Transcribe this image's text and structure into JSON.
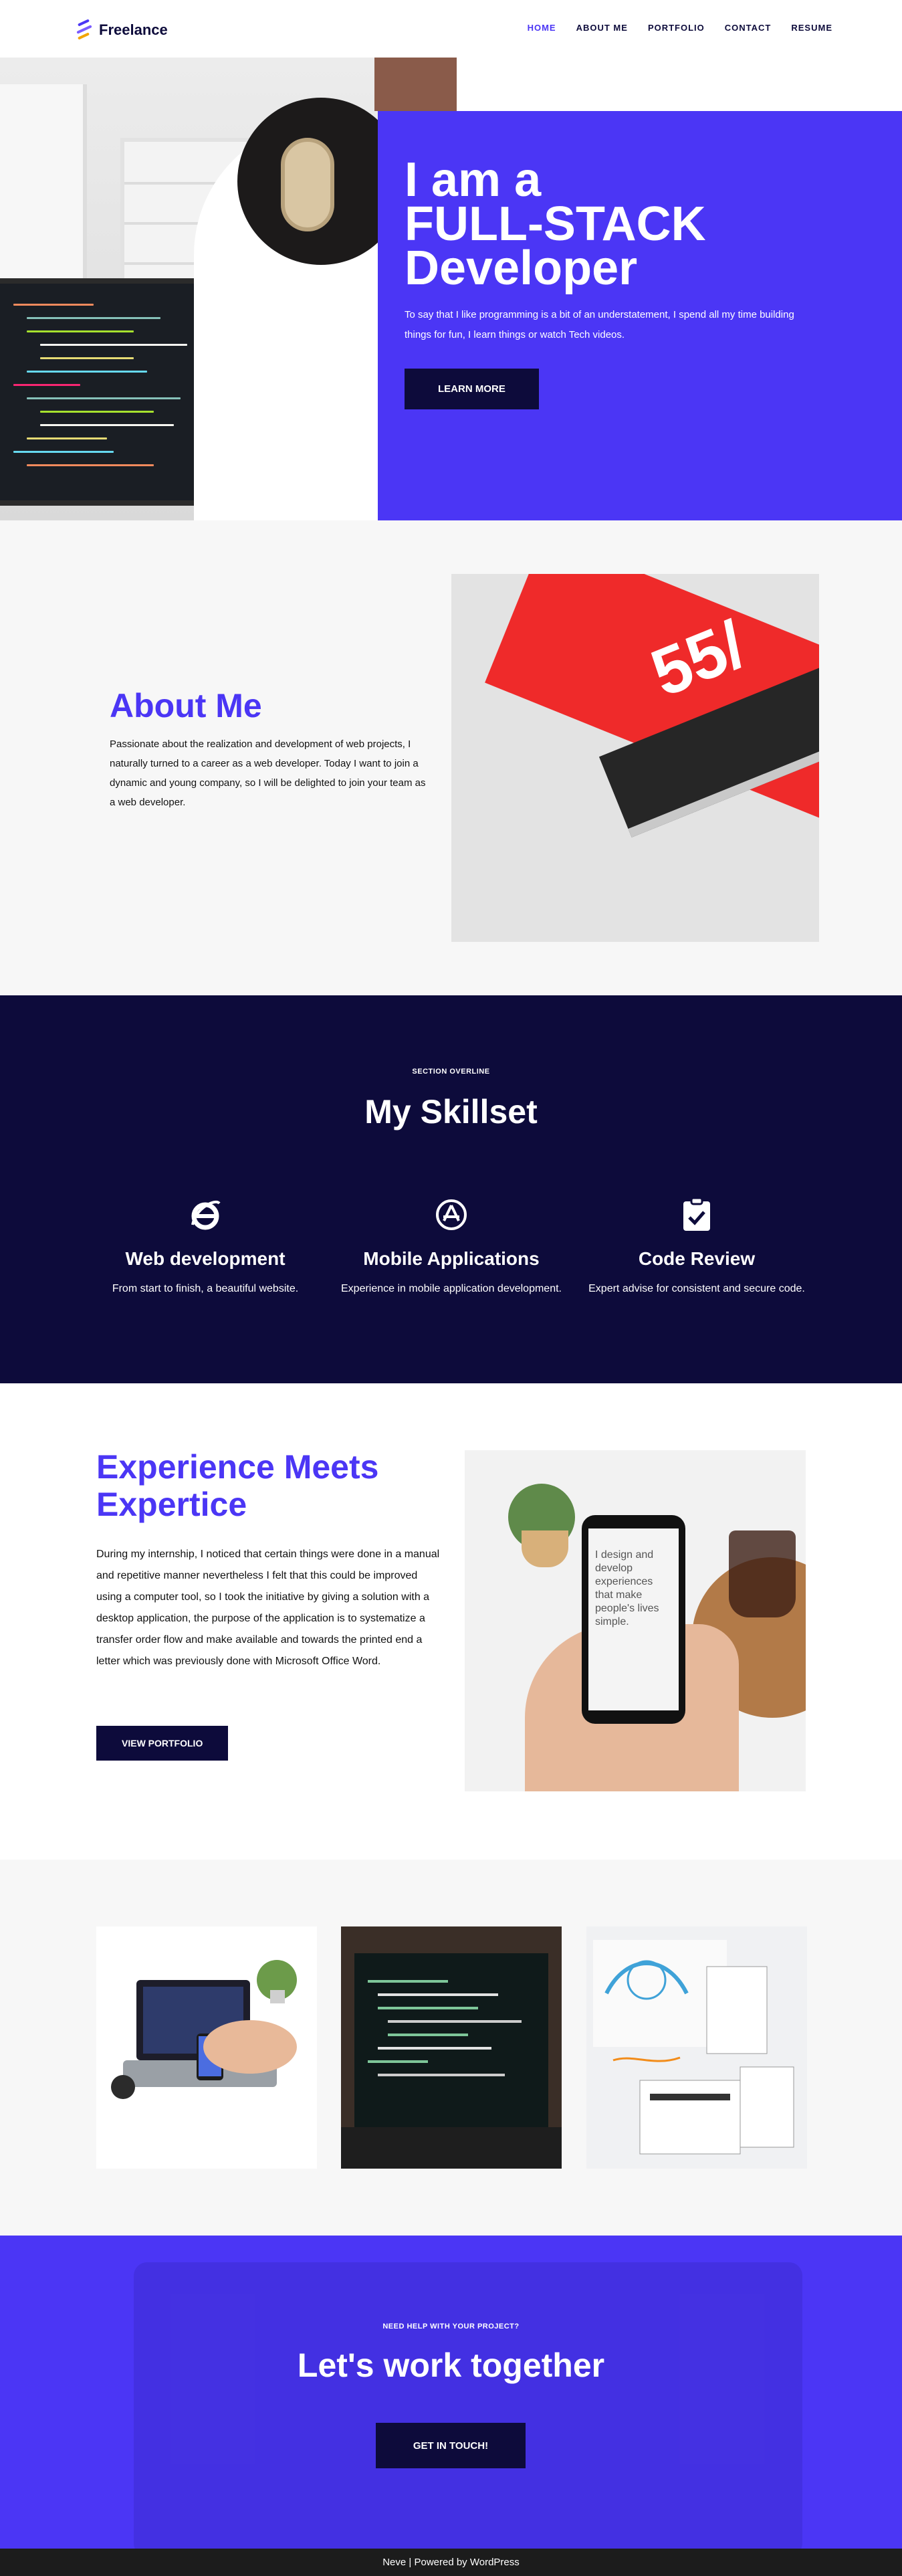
{
  "header": {
    "logo_text": "Freelance",
    "nav": [
      "HOME",
      "ABOUT ME",
      "PORTFOLIO",
      "CONTACT",
      "RESUME"
    ],
    "active": "HOME"
  },
  "hero": {
    "title_line1": "I am a",
    "title_line2": "FULL-STACK",
    "title_line3": "Developer",
    "subtitle": "To say that I like programming is a bit of an understatement, I spend all my time building things for fun, I learn things or watch Tech videos.",
    "button": "LEARN MORE"
  },
  "about": {
    "title": "About Me",
    "text": "Passionate about the realization and development of web projects, I naturally turned to a career as a web developer. Today I want to join a dynamic and young company, so I will be delighted to join your team as a web developer.",
    "image_text": "55/"
  },
  "skills": {
    "overline": "SECTION OVERLINE",
    "title": "My Skillset",
    "items": [
      {
        "icon": "internet-explorer-icon",
        "title": "Web development",
        "text": "From start to finish, a beautiful website."
      },
      {
        "icon": "app-store-icon",
        "title": "Mobile Applications",
        "text": "Experience in mobile application development."
      },
      {
        "icon": "clipboard-check-icon",
        "title": "Code Review",
        "text": "Expert advise for consistent and secure code."
      }
    ]
  },
  "experience": {
    "title": "Experience Meets Expertice",
    "text": "During my internship, I noticed that certain things were done in a manual and repetitive manner nevertheless I felt that this could be improved using a computer tool, so I took the initiative by giving a solution with a desktop application, the purpose of the application is to systematize a transfer order flow and make available and towards the printed end a letter which was previously done with Microsoft Office Word.",
    "button": "VIEW PORTFOLIO",
    "phone_text": "I design and develop experiences that make people's lives simple."
  },
  "cta": {
    "overline": "NEED HELP WITH YOUR PROJECT?",
    "title": "Let's work together",
    "button": "GET IN TOUCH!"
  },
  "footer": {
    "text": "Neve | Powered by WordPress"
  },
  "colors": {
    "accent": "#4b36f5",
    "dark": "#0d0b3b",
    "light_bg": "#f7f7f7",
    "footer": "#1c1c1c"
  }
}
